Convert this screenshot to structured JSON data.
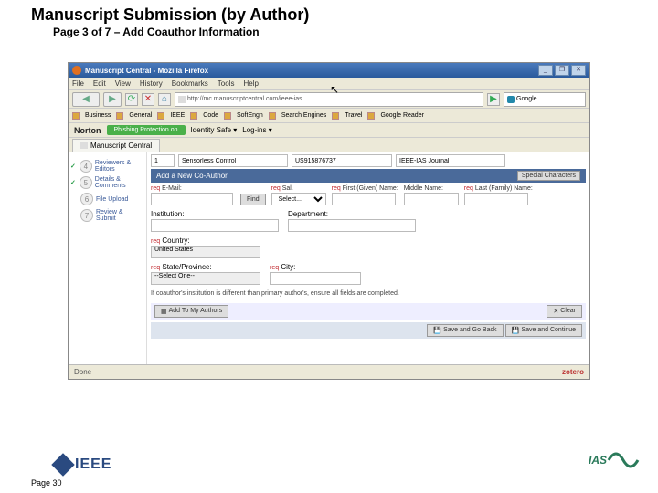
{
  "slide": {
    "title": "Manuscript Submission (by Author)",
    "subtitle": "Page 3 of 7 – Add Coauthor Information",
    "page_footer": "Page 30"
  },
  "branding": {
    "ieee": "IEEE",
    "ias": "IAS"
  },
  "window": {
    "title": "Manuscript Central - Mozilla Firefox",
    "btn_min": "_",
    "btn_max": "❐",
    "btn_close": "✕"
  },
  "menubar": [
    "File",
    "Edit",
    "View",
    "History",
    "Bookmarks",
    "Tools",
    "Help"
  ],
  "address": {
    "url": "http://mc.manuscriptcentral.com/ieee-ias",
    "search_placeholder": "Google"
  },
  "bookmarks": [
    "Business",
    "General",
    "IEEE",
    "Code",
    "SoftEngn",
    "Search Engines",
    "Travel",
    "Google Reader"
  ],
  "norton": {
    "brand": "Norton",
    "phish": "Phishing Protection on",
    "id": "Identity Safe ▾",
    "log": "Log-ins ▾"
  },
  "tab": "Manuscript Central",
  "steps": [
    {
      "num": "4",
      "label": "Reviewers & Editors",
      "checked": true
    },
    {
      "num": "5",
      "label": "Details & Comments",
      "checked": true
    },
    {
      "num": "6",
      "label": "File Upload",
      "checked": false
    },
    {
      "num": "7",
      "label": "Review & Submit",
      "checked": false
    }
  ],
  "header_fields": {
    "a": "1",
    "b": "Sensorless Control",
    "c": "US915876737",
    "d": "IEEE-IAS Journal"
  },
  "coauthor": {
    "section_title": "Add a New Co-Author",
    "special": "Special Characters",
    "email_label": "E-Mail:",
    "find": "Find",
    "salutation_label": "Sal.",
    "salutation_val": "Select...",
    "first_label": "First (Given) Name:",
    "middle_label": "Middle Name:",
    "last_label": "Last (Family) Name:",
    "institution_label": "Institution:",
    "department_label": "Department:",
    "country_label": "Country:",
    "country_val": "United States",
    "state_label": "State/Province:",
    "state_val": "--Select One--",
    "city_label": "City:",
    "note": "If coauthor's institution is different than primary author's, ensure all fields are completed.",
    "add_btn": "Add To My Authors",
    "clear_btn": "Clear",
    "save_back": "Save and Go Back",
    "save_cont": "Save and Continue"
  },
  "status": {
    "left": "Done",
    "right": "zotero"
  }
}
